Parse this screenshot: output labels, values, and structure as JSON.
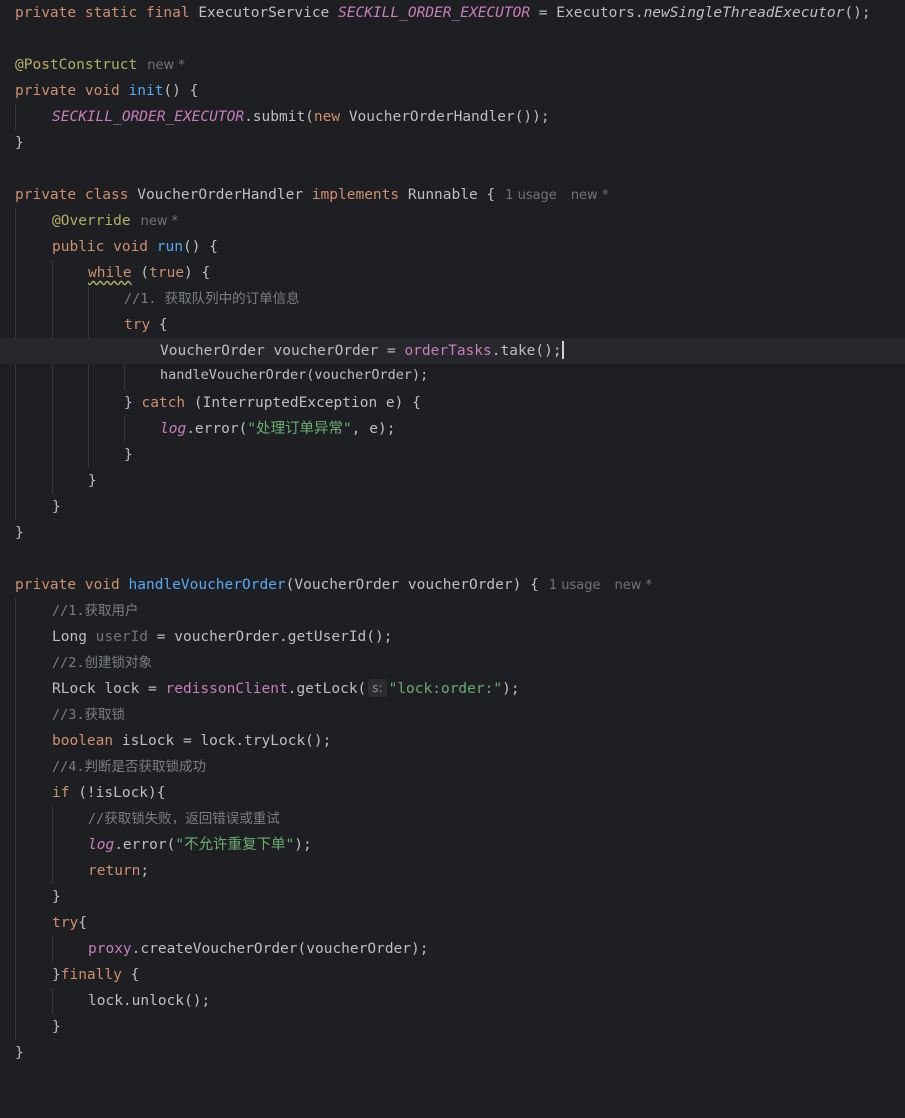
{
  "meta": {
    "new_marker": "new *",
    "usage_1": "1 usage"
  },
  "code": {
    "l1": {
      "a": "private static final ",
      "b": "ExecutorService ",
      "c": "SECKILL_ORDER_EXECUTOR",
      "d": " = Executors.",
      "e": "newSingleThreadExecutor",
      "f": "();"
    },
    "l3": {
      "a": "@PostConstruct"
    },
    "l4": {
      "a": "private void ",
      "b": "init",
      "c": "() {"
    },
    "l5": {
      "a": "SECKILL_ORDER_EXECUTOR",
      "b": ".submit(",
      "c": "new ",
      "d": "VoucherOrderHandler());"
    },
    "l6": {
      "a": "}"
    },
    "l8": {
      "a": "private class ",
      "b": "VoucherOrderHandler ",
      "c": "implements ",
      "d": "Runnable {"
    },
    "l9": {
      "a": "@Override"
    },
    "l10": {
      "a": "public void ",
      "b": "run",
      "c": "() {"
    },
    "l11": {
      "a": "while",
      "b": " (",
      "c": "true",
      "d": ") {"
    },
    "l12": {
      "a": "//1. 获取队列中的订单信息"
    },
    "l13": {
      "a": "try",
      "b": " {"
    },
    "l14": {
      "a": "VoucherOrder voucherOrder = ",
      "b": "orderTasks",
      "c": ".take();"
    },
    "l15": {
      "a": "handleVoucherOrder(voucherOrder);"
    },
    "l16": {
      "a": "} ",
      "b": "catch",
      "c": " (InterruptedException e) {"
    },
    "l17": {
      "a": "log",
      "b": ".error(",
      "c": "\"处理订单异常\"",
      "d": ", e);"
    },
    "l18": {
      "a": "}"
    },
    "l19": {
      "a": "}"
    },
    "l20": {
      "a": "}"
    },
    "l21": {
      "a": "}"
    },
    "l23": {
      "a": "private void ",
      "b": "handleVoucherOrder",
      "c": "(VoucherOrder voucherOrder) {"
    },
    "l24": {
      "a": "//1.获取用户"
    },
    "l25": {
      "a": "Long ",
      "b": "userId",
      "c": " = voucherOrder.getUserId();"
    },
    "l26": {
      "a": "//2.创建锁对象"
    },
    "l27": {
      "a": "RLock lock = ",
      "b": "redissonClient",
      "c": ".getLock(",
      "hint": "s:",
      "d": "\"lock:order:\"",
      "e": ");"
    },
    "l28": {
      "a": "//3.获取锁"
    },
    "l29": {
      "a": "boolean ",
      "b": "isLock = lock.tryLock();"
    },
    "l30": {
      "a": "//4.判断是否获取锁成功"
    },
    "l31": {
      "a": "if",
      "b": " (!isLock){"
    },
    "l32": {
      "a": "//获取锁失败，返回错误或重试"
    },
    "l33": {
      "a": "log",
      "b": ".error(",
      "c": "\"不允许重复下单\"",
      "d": ");"
    },
    "l34": {
      "a": "return",
      "b": ";"
    },
    "l35": {
      "a": "}"
    },
    "l36": {
      "a": "try",
      "b": "{"
    },
    "l37": {
      "a": "proxy",
      "b": ".createVoucherOrder(voucherOrder);"
    },
    "l38": {
      "a": "}",
      "b": "finally",
      "c": " {"
    },
    "l39": {
      "a": "lock.unlock();"
    },
    "l40": {
      "a": "}"
    },
    "l41": {
      "a": "}"
    }
  }
}
